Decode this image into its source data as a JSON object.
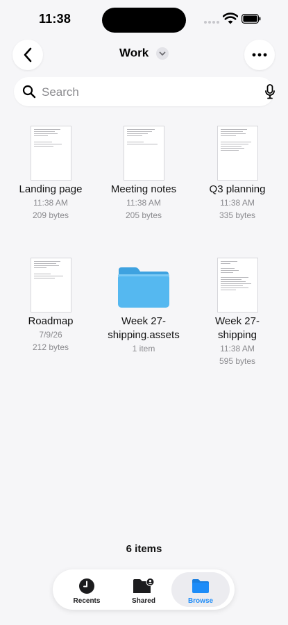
{
  "status_bar": {
    "time": "11:38"
  },
  "nav": {
    "title": "Work"
  },
  "search": {
    "placeholder": "Search"
  },
  "items": [
    {
      "name_line1": "Landing page",
      "name_line2": "",
      "date": "11:38 AM",
      "size": "209 bytes"
    },
    {
      "name_line1": "Meeting notes",
      "name_line2": "",
      "date": "11:38 AM",
      "size": "205 bytes"
    },
    {
      "name_line1": "Q3 planning",
      "name_line2": "",
      "date": "11:38 AM",
      "size": "335 bytes"
    },
    {
      "name_line1": "Roadmap",
      "name_line2": "",
      "date": "7/9/26",
      "size": "212 bytes"
    },
    {
      "name_line1": "Week 27-",
      "name_line2": "shipping.assets",
      "date": "",
      "size": "1 item"
    },
    {
      "name_line1": "Week 27-",
      "name_line2": "shipping",
      "date": "11:38 AM",
      "size": "595 bytes"
    }
  ],
  "footer": {
    "count": "6 items"
  },
  "tabs": [
    {
      "label": "Recents",
      "icon": "clock-icon"
    },
    {
      "label": "Shared",
      "icon": "shared-folder-icon"
    },
    {
      "label": "Browse",
      "icon": "folder-icon"
    }
  ],
  "colors": {
    "accent": "#1d8cf8",
    "folder": "#4fb3ee",
    "background": "#f6f6f8"
  }
}
